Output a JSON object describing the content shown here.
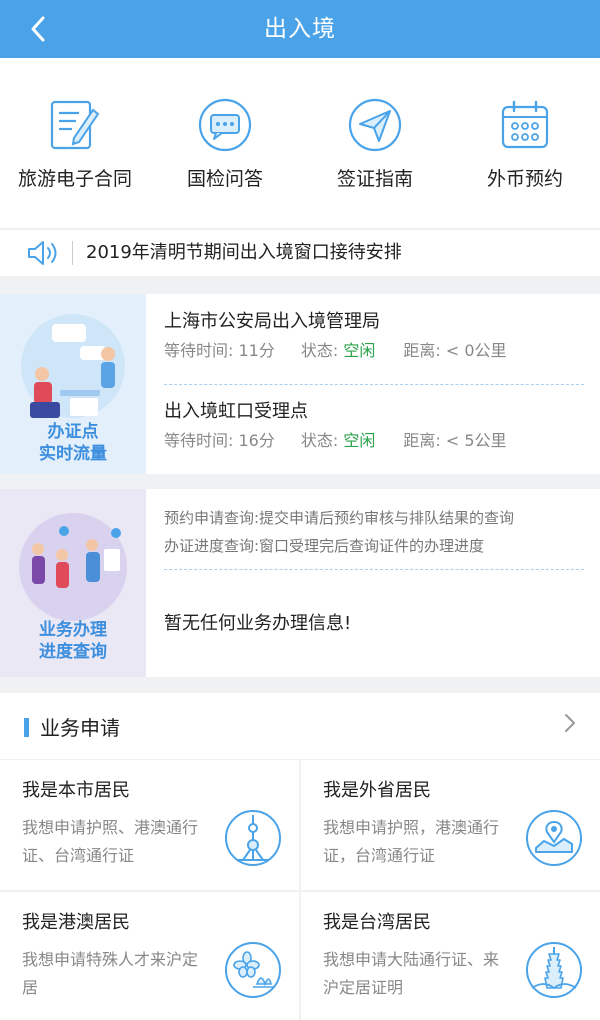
{
  "header": {
    "title": "出入境",
    "back_icon": "chevron-left-icon"
  },
  "quick_actions": [
    {
      "label": "旅游电子合同",
      "icon": "contract-icon"
    },
    {
      "label": "国检问答",
      "icon": "chat-bubble-icon"
    },
    {
      "label": "签证指南",
      "icon": "paper-plane-icon"
    },
    {
      "label": "外币预约",
      "icon": "calendar-icon"
    }
  ],
  "notice": {
    "text": "2019年清明节期间出入境窗口接待安排",
    "icon": "speaker-icon"
  },
  "flow_card": {
    "image_label_1": "办证点",
    "image_label_2": "实时流量",
    "offices": [
      {
        "name": "上海市公安局出入境管理局",
        "wait": "等待时间: 11分",
        "status_label": "状态:",
        "status": "空闲",
        "distance": "距离: < 0公里"
      },
      {
        "name": "出入境虹口受理点",
        "wait": "等待时间: 16分",
        "status_label": "状态:",
        "status": "空闲",
        "distance": "距离: < 5公里"
      }
    ]
  },
  "progress_card": {
    "image_label_1": "业务办理",
    "image_label_2": "进度查询",
    "line_1": "预约申请查询:提交申请后预约审核与排队结果的查询",
    "line_2": "办证进度查询:窗口受理完后查询证件的办理进度",
    "empty": "暂无任何业务办理信息!"
  },
  "business": {
    "title": "业务申请",
    "items": [
      {
        "title": "我是本市居民",
        "desc": "我想申请护照、港澳通行证、台湾通行证",
        "icon": "pearl-tower-icon"
      },
      {
        "title": "我是外省居民",
        "desc": "我想申请护照，港澳通行证，台湾通行证",
        "icon": "map-pin-icon"
      },
      {
        "title": "我是港澳居民",
        "desc": "我想申请特殊人才来沪定居",
        "icon": "bauhinia-lotus-icon"
      },
      {
        "title": "我是台湾居民",
        "desc": "我想申请大陆通行证、来沪定居证明",
        "icon": "taipei-101-icon"
      }
    ]
  },
  "colors": {
    "primary": "#4aa3e8",
    "status_ok": "#2aa34a",
    "page_bg": "#f0f1f3"
  }
}
